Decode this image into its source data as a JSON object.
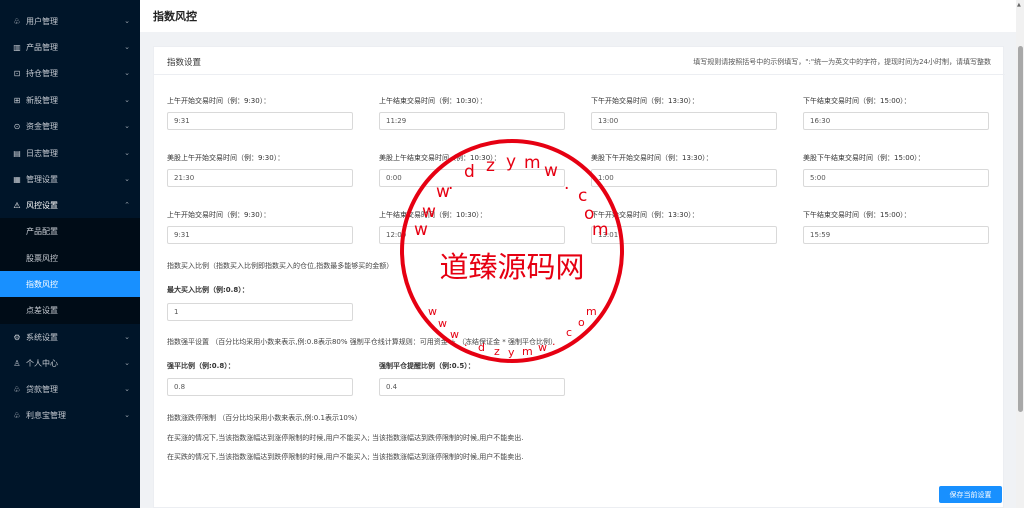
{
  "sidebar": {
    "items": [
      {
        "label": "用户管理",
        "icon": "users-icon"
      },
      {
        "label": "产品管理",
        "icon": "chart-icon"
      },
      {
        "label": "持仓管理",
        "icon": "box-icon"
      },
      {
        "label": "新股管理",
        "icon": "new-icon"
      },
      {
        "label": "资金管理",
        "icon": "money-icon"
      },
      {
        "label": "日志管理",
        "icon": "log-icon"
      },
      {
        "label": "管理设置",
        "icon": "settings-icon"
      },
      {
        "label": "风控设置",
        "icon": "warning-icon"
      }
    ],
    "submenu": [
      "产品配置",
      "股票风控",
      "指数风控",
      "点差设置"
    ],
    "items_after": [
      {
        "label": "系统设置",
        "icon": "gear-icon"
      },
      {
        "label": "个人中心",
        "icon": "person-icon"
      },
      {
        "label": "贷款管理",
        "icon": "loan-icon"
      },
      {
        "label": "利息宝管理",
        "icon": "interest-icon"
      }
    ]
  },
  "header": {
    "title": "指数风控"
  },
  "card": {
    "title": "指数设置",
    "hint": "填写规则请按照括号中的示例填写，\":\"统一为英文中的字符，提现时间为24小时制，请填写整数"
  },
  "row1": {
    "labels": [
      "上午开始交易时间（例：9:30）：",
      "上午结束交易时间（例：10:30）：",
      "下午开始交易时间（例：13:30）：",
      "下午结束交易时间（例：15:00）："
    ],
    "values": [
      "9:31",
      "11:29",
      "13:00",
      "16:30"
    ]
  },
  "row2": {
    "labels": [
      "美股上午开始交易时间（例：9:30）：",
      "美股上午结束交易时间（例：10:30）：",
      "美股下午开始交易时间（例：13:30）：",
      "美股下午结束交易时间（例：15:00）："
    ],
    "values": [
      "21:30",
      "0:00",
      "1:00",
      "5:00"
    ]
  },
  "row3": {
    "labels": [
      "上午开始交易时间（例：9:30）：",
      "上午结束交易时间（例：10:30）：",
      "下午开始交易时间（例：13:30）：",
      "下午结束交易时间（例：15:00）："
    ],
    "values": [
      "9:31",
      "12:00",
      "13:01",
      "15:59"
    ]
  },
  "buy": {
    "section": "指数买入比例（指数买入比例即指数买入的仓位,指数最多能够买的金额）",
    "label": "最大买入比例（例:0.8）：",
    "value": "1"
  },
  "liquidation": {
    "section": "指数强平设置 （百分比均采用小数来表示,例:0.8表示80% 强制平仓线计算规则：可用资金 + （冻结保证金 * 强制平仓比例）",
    "label1": "强平比例（例:0.8）：",
    "value1": "0.8",
    "label2": "强制平仓提醒比例（例:0.5）：",
    "value2": "0.4"
  },
  "limit": {
    "section": "指数涨跌停限制 （百分比均采用小数来表示,例:0.1表示10%）",
    "line1": "在买涨的情况下,当该指数涨幅达到涨停限制的时候,用户不能买入; 当该指数涨幅达到跌停限制的时候,用户不能卖出.",
    "line2": "在买跌的情况下,当该指数涨幅达到跌停限制的时候,用户不能买入; 当该指数涨幅达到涨停限制的时候,用户不能卖出."
  },
  "save_label": "保存当前设置",
  "watermark": {
    "text": "道臻源码网",
    "color": "#e60012"
  }
}
